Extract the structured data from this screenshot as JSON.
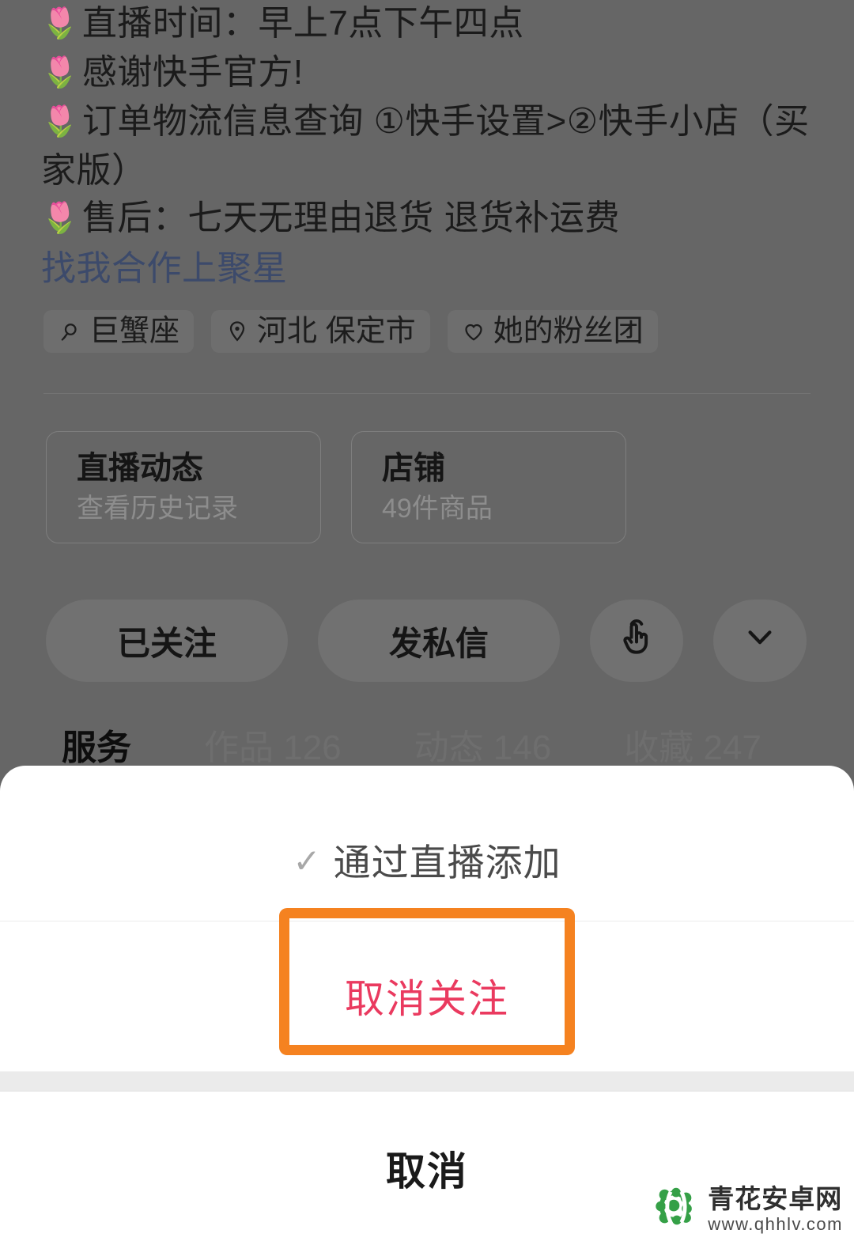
{
  "profile": {
    "bio_lines": [
      {
        "emoji": "🌷",
        "text": "直播时间：早上7点下午四点"
      },
      {
        "emoji": "🌷",
        "text": "感谢快手官方!"
      },
      {
        "emoji": "🌷",
        "text": "订单物流信息查询 ①快手设置>②快手小店（买家版）"
      },
      {
        "emoji": "🌷",
        "text": "售后：七天无理由退货 退货补运费"
      }
    ],
    "bio_link": "找我合作上聚星",
    "chips": [
      {
        "icon": "zodiac-cancer-icon",
        "label": "巨蟹座"
      },
      {
        "icon": "location-pin-icon",
        "label": "河北 保定市"
      },
      {
        "icon": "heart-icon",
        "label": "她的粉丝团"
      }
    ],
    "cards": [
      {
        "title": "直播动态",
        "subtitle": "查看历史记录"
      },
      {
        "title": "店铺",
        "subtitle": "49件商品"
      }
    ],
    "actions": {
      "follow_label": "已关注",
      "message_label": "发私信",
      "tap_icon": "hand-tap-icon",
      "more_icon": "chevron-down-icon"
    },
    "tabs": [
      {
        "label": "服务",
        "active": true
      },
      {
        "label": "作品 126",
        "active": false
      },
      {
        "label": "动态 146",
        "active": false
      },
      {
        "label": "收藏 247",
        "active": false
      }
    ]
  },
  "sheet": {
    "option_source": {
      "check_glyph": "✓",
      "label": "通过直播添加"
    },
    "unfollow_label": "取消关注",
    "cancel_label": "取消"
  },
  "annotation": {
    "highlight_color": "#f58220",
    "target": "取消关注"
  },
  "watermark": {
    "title": "青花安卓网",
    "url": "www.qhhlv.com",
    "logo_color": "#35a047"
  },
  "colors": {
    "dim_overlay": "#666666",
    "sheet_background": "#ffffff",
    "danger_text": "#ea3a5f",
    "link_text": "#3c4a6b",
    "highlight_orange": "#f58220"
  }
}
